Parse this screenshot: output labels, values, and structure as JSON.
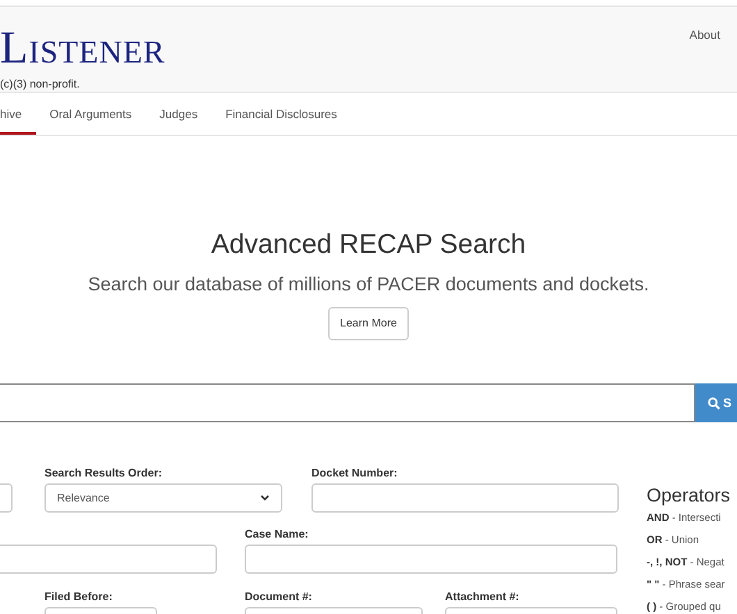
{
  "header": {
    "logo": "Listener",
    "tagline": "(c)(3) non-profit.",
    "about_link": "About"
  },
  "tabs": [
    {
      "label": "hive",
      "selected": true
    },
    {
      "label": "Oral Arguments",
      "selected": false
    },
    {
      "label": "Judges",
      "selected": false
    },
    {
      "label": "Financial Disclosures",
      "selected": false
    }
  ],
  "hero": {
    "title": "Advanced RECAP Search",
    "subtitle": "Search our database of millions of PACER documents and dockets.",
    "button": "Learn More"
  },
  "search": {
    "button": "S"
  },
  "form": {
    "row_1": [
      {
        "kind": "field"
      },
      {
        "kind": "select",
        "label": "Search Results Order:",
        "value": "Relevance"
      },
      {
        "kind": "field",
        "label": "Docket Number:"
      }
    ],
    "row_2": [
      {
        "kind": "field"
      },
      {
        "kind": "field",
        "label": "Case Name:"
      }
    ],
    "row_3": [
      {
        "kind": "field",
        "label": "Filed Before:"
      },
      {
        "kind": "field",
        "label": "Document #:"
      },
      {
        "kind": "field",
        "label": "Attachment #:"
      }
    ]
  },
  "operators": {
    "title": "Operators",
    "items": [
      {
        "term": "AND",
        "text": " - Intersecti"
      },
      {
        "term": "OR",
        "text": " - Union"
      },
      {
        "term": "-, !, NOT",
        "text": " - Negat"
      },
      {
        "term": "\" \"",
        "text": " - Phrase sear"
      },
      {
        "term": "( )",
        "text": " - Grouped qu"
      }
    ]
  }
}
